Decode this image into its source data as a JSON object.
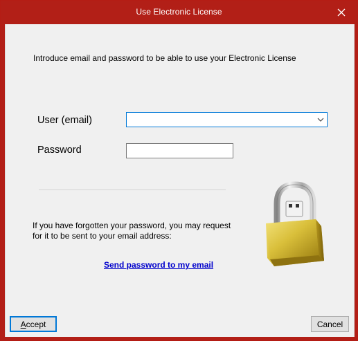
{
  "window": {
    "title": "Use Electronic License",
    "close_glyph": "✕"
  },
  "form": {
    "intro": "Introduce email and password to be able to use your Electronic License",
    "user_label": "User (email)",
    "user_value": "",
    "password_label": "Password",
    "password_value": ""
  },
  "forgot": {
    "line1": "If you have forgotten your password, you may request",
    "line2": "for it to be sent to your email address:",
    "link_label": "Send password to my email"
  },
  "buttons": {
    "accept_prefix": "",
    "accept_underlined": "A",
    "accept_rest": "ccept",
    "cancel": "Cancel"
  },
  "icons": {
    "close": "close-icon",
    "combo_arrow": "chevron-down-icon",
    "lock": "padlock-icon"
  },
  "colors": {
    "titlebar": "#b21f17",
    "focus_accent": "#0078d7",
    "link": "#0000cc"
  }
}
